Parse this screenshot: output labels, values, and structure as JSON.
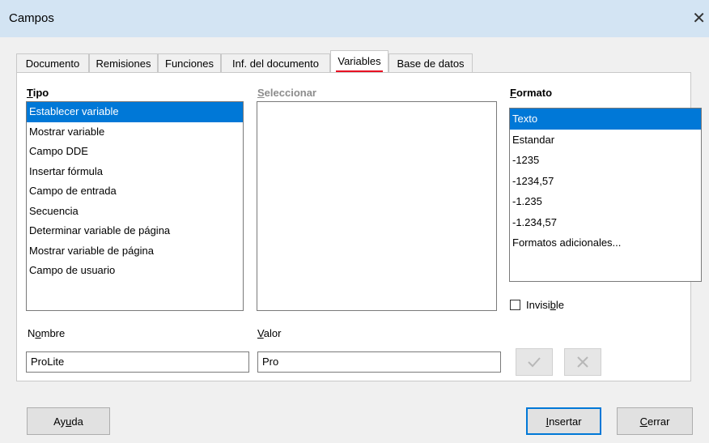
{
  "window": {
    "title": "Campos",
    "close_glyph": "✕"
  },
  "tabs": [
    {
      "label": "Documento"
    },
    {
      "label": "Remisiones"
    },
    {
      "label": "Funciones"
    },
    {
      "label": "Inf. del documento"
    },
    {
      "label": "Variables"
    },
    {
      "label": "Base de datos"
    }
  ],
  "active_tab": "Variables",
  "type_section": {
    "heading": "Tipo",
    "items": [
      "Establecer variable",
      "Mostrar variable",
      "Campo DDE",
      "Insertar fórmula",
      "Campo de entrada",
      "Secuencia",
      "Determinar variable de página",
      "Mostrar variable de página",
      "Campo de usuario"
    ],
    "selected": "Establecer variable"
  },
  "select_section": {
    "heading": "Seleccionar",
    "items": []
  },
  "format_section": {
    "heading": "Formato",
    "items": [
      "Texto",
      "Estandar",
      "-1235",
      "-1234,57",
      "-1.235",
      "-1.234,57",
      "Formatos adicionales..."
    ],
    "selected": "Texto"
  },
  "invisible": {
    "label": "Invisible",
    "checked": false
  },
  "name_field": {
    "label": "Nombre",
    "value": "ProLite"
  },
  "value_field": {
    "label": "Valor",
    "value": "Pro"
  },
  "buttons": {
    "help": "Ayuda",
    "insert": "Insertar",
    "close": "Cerrar"
  },
  "icons": {
    "apply": "check-icon",
    "delete": "x-icon"
  },
  "colors": {
    "selection": "#0078d7",
    "active_tab_underline": "#e81123",
    "titlebar": "#d3e4f3"
  }
}
